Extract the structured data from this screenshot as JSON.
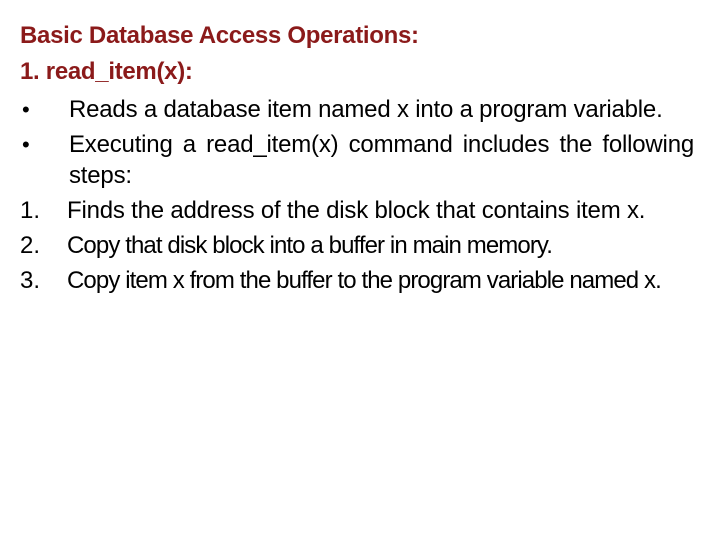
{
  "slide": {
    "title": "Basic Database Access Operations:",
    "subtitle": "1. read_item(x):",
    "accent_color": "#8b1a1a",
    "items": [
      {
        "marker": "•",
        "text": "Reads a database item named x into a program variable."
      },
      {
        "marker": "•",
        "text": "Executing a read_item(x) command includes the following steps:"
      },
      {
        "marker": "1.",
        "text": "Finds the address of the disk block that contains item x."
      },
      {
        "marker": "2.",
        "text": "Copy that disk block into a buffer in main memory."
      },
      {
        "marker": "3.",
        "text": "Copy item x from the buffer to the program variable named x."
      }
    ]
  }
}
